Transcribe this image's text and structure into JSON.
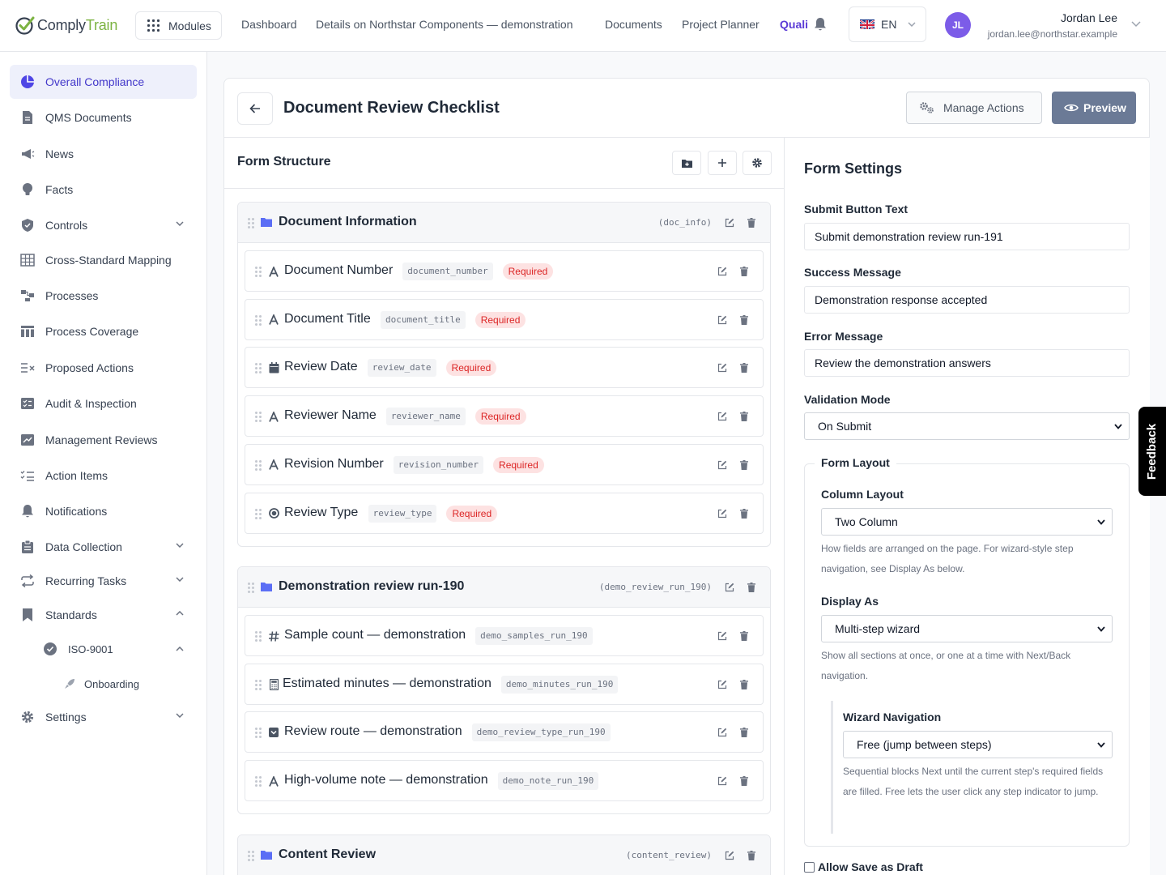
{
  "app": {
    "logo_prefix": "Comply",
    "logo_suffix": "Train",
    "brand_color": "#7cb342",
    "accent_color": "#5b3bd6"
  },
  "topbar": {
    "modules_label": "Modules",
    "nav": [
      {
        "label": "Dashboard"
      },
      {
        "label": "Details on Northstar Components — demonstration"
      },
      {
        "label": "Documents"
      },
      {
        "label": "Project Planner"
      },
      {
        "label": "Quali"
      }
    ],
    "language": "EN",
    "user": {
      "initials": "JL",
      "name": "Jordan Lee",
      "email": "jordan.lee@northstar.example"
    }
  },
  "sidebar": {
    "items": [
      {
        "label": "Overall Compliance",
        "icon": "pie-chart-icon"
      },
      {
        "label": "QMS Documents",
        "icon": "document-icon"
      },
      {
        "label": "News",
        "icon": "megaphone-icon"
      },
      {
        "label": "Facts",
        "icon": "lightbulb-icon"
      },
      {
        "label": "Controls",
        "icon": "shield-icon"
      },
      {
        "label": "Cross-Standard Mapping",
        "icon": "table-icon"
      },
      {
        "label": "Processes",
        "icon": "flow-icon"
      },
      {
        "label": "Process Coverage",
        "icon": "columns-icon"
      },
      {
        "label": "Proposed Actions",
        "icon": "list-x-icon"
      },
      {
        "label": "Audit & Inspection",
        "icon": "checklist-icon"
      },
      {
        "label": "Management Reviews",
        "icon": "chart-icon"
      },
      {
        "label": "Action Items",
        "icon": "list-check-icon"
      },
      {
        "label": "Notifications",
        "icon": "bell-icon"
      },
      {
        "label": "Data Collection",
        "icon": "clipboard-icon"
      },
      {
        "label": "Recurring Tasks",
        "icon": "repeat-icon"
      },
      {
        "label": "Standards",
        "icon": "bookmark-icon"
      },
      {
        "label": "ISO-9001",
        "icon": "badge-check-icon"
      },
      {
        "label": "Onboarding",
        "icon": "rocket-icon"
      },
      {
        "label": "Settings",
        "icon": "gear-icon"
      }
    ]
  },
  "page": {
    "title": "Document Review Checklist",
    "manage_actions_label": "Manage Actions",
    "preview_label": "Preview"
  },
  "form_structure": {
    "title": "Form Structure",
    "required_label": "Required",
    "sections": [
      {
        "title": "Document Information",
        "key": "(doc_info)",
        "fields": [
          {
            "label": "Document Number",
            "key": "document_number",
            "type": "text",
            "required": true
          },
          {
            "label": "Document Title",
            "key": "document_title",
            "type": "text",
            "required": true
          },
          {
            "label": "Review Date",
            "key": "review_date",
            "type": "date",
            "required": true
          },
          {
            "label": "Reviewer Name",
            "key": "reviewer_name",
            "type": "text",
            "required": true
          },
          {
            "label": "Revision Number",
            "key": "revision_number",
            "type": "text",
            "required": true
          },
          {
            "label": "Review Type",
            "key": "review_type",
            "type": "radio",
            "required": true
          }
        ]
      },
      {
        "title": "Demonstration review run-190",
        "key": "(demo_review_run_190)",
        "fields": [
          {
            "label": "Sample count — demonstration",
            "key": "demo_samples_run_190",
            "type": "number",
            "required": false
          },
          {
            "label": "Estimated minutes — demonstration",
            "key": "demo_minutes_run_190",
            "type": "calc",
            "required": false
          },
          {
            "label": "Review route — demonstration",
            "key": "demo_review_type_run_190",
            "type": "select",
            "required": false
          },
          {
            "label": "High-volume note — demonstration",
            "key": "demo_note_run_190",
            "type": "text",
            "required": false
          }
        ]
      },
      {
        "title": "Content Review",
        "key": "(content_review)",
        "fields": []
      }
    ]
  },
  "form_settings": {
    "title": "Form Settings",
    "submit_label": "Submit Button Text",
    "submit_value": "Submit demonstration review run-191",
    "success_label": "Success Message",
    "success_value": "Demonstration response accepted",
    "error_label": "Error Message",
    "error_value": "Review the demonstration answers",
    "validation_label": "Validation Mode",
    "validation_value": "On Submit",
    "layout_legend": "Form Layout",
    "column_label": "Column Layout",
    "column_value": "Two Column",
    "column_help": "How fields are arranged on the page. For wizard-style step navigation, see Display As below.",
    "display_label": "Display As",
    "display_value": "Multi-step wizard",
    "display_help": "Show all sections at once, or one at a time with Next/Back navigation.",
    "wizard_label": "Wizard Navigation",
    "wizard_value": "Free (jump between steps)",
    "wizard_help": "Sequential blocks Next until the current step's required fields are filled. Free lets the user click any step indicator to jump.",
    "draft_label": "Allow Save as Draft",
    "draft_checked": false
  },
  "feedback_label": "Feedback"
}
